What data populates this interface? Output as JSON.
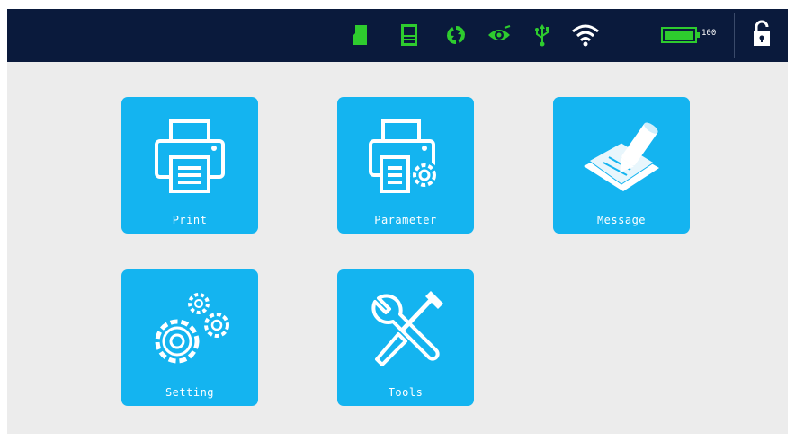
{
  "status_bar": {
    "battery_text": "100",
    "icons": [
      "sd-card-icon",
      "device-icon",
      "sync-icon",
      "eye-icon",
      "usb-icon",
      "wifi-icon",
      "battery-icon",
      "lock-icon"
    ],
    "colors": {
      "background": "#0a1a3c",
      "indicator": "#2ecc2e"
    }
  },
  "menu": {
    "tiles": [
      {
        "label": "Print",
        "icon": "printer-icon"
      },
      {
        "label": "Parameter",
        "icon": "printer-settings-icon"
      },
      {
        "label": "Message",
        "icon": "message-edit-icon"
      },
      {
        "label": "Setting",
        "icon": "gears-icon"
      },
      {
        "label": "Tools",
        "icon": "tools-icon"
      }
    ],
    "tile_color": "#14b4f0",
    "background_color": "#ececec"
  }
}
